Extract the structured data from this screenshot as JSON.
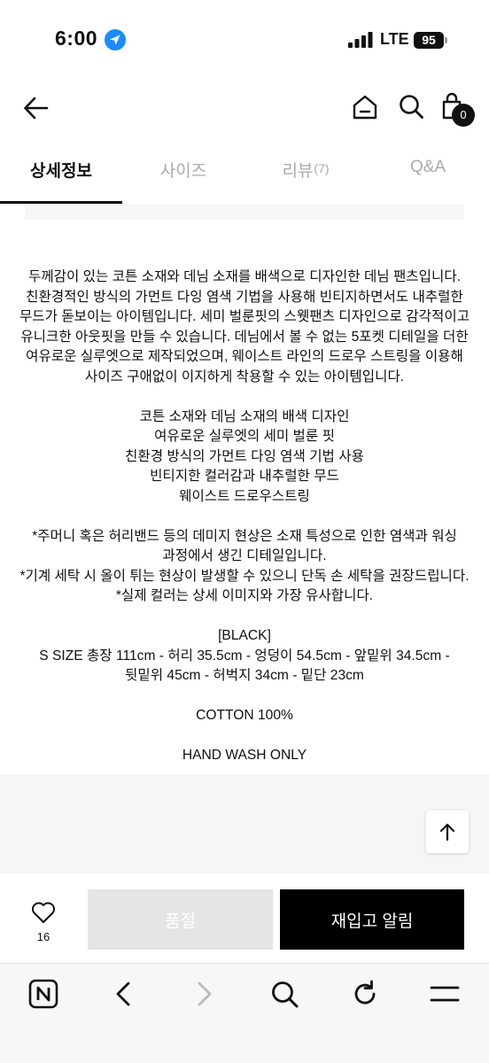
{
  "status_bar": {
    "time": "6:00",
    "network": "LTE",
    "battery": "95"
  },
  "header": {
    "cart_count": "0"
  },
  "tabs": [
    {
      "label": "상세정보",
      "count": ""
    },
    {
      "label": "사이즈",
      "count": ""
    },
    {
      "label": "리뷰",
      "count": "(7)"
    },
    {
      "label": "Q&A",
      "count": ""
    }
  ],
  "description": {
    "intro": [
      "두께감이 있는 코튼 소재와 데님 소재를 배색으로 디자인한 데님 팬츠입니다.",
      "친환경적인 방식의 가먼트 다잉 염색 기법을 사용해 빈티지하면서도 내추럴한",
      "무드가 돋보이는 아이템입니다. 세미 벌룬핏의 스웻팬츠 디자인으로 감각적이고",
      "유니크한 아웃핏을 만들 수 있습니다. 데님에서 볼 수 없는 5포켓 디테일을 더한",
      "여유로운 실루엣으로 제작되었으며, 웨이스트 라인의 드로우 스트링을 이용해",
      "사이즈 구애없이 이지하게 착용할 수 있는 아이템입니다."
    ],
    "features": [
      "코튼 소재와 데님 소재의 배색 디자인",
      "여유로운 실루엣의 세미 벌룬 핏",
      "친환경 방식의 가먼트 다잉 염색 기법 사용",
      "빈티지한 컬러감과 내추럴한 무드",
      "웨이스트 드로우스트링"
    ],
    "notes": [
      "*주머니 혹은 허리밴드 등의 데미지 현상은 소재 특성으로 인한 염색과 워싱",
      "과정에서 생긴 디테일입니다.",
      "*기계 세탁 시 올이 튀는 현상이 발생할 수 있으니 단독 손 세탁을 권장드립니다.",
      "*실제 컬러는 상세 이미지와 가장 유사합니다."
    ],
    "size_info": [
      "[BLACK]",
      "S SIZE 총장 111cm - 허리 35.5cm - 엉덩이 54.5cm - 앞밑위 34.5cm -",
      "뒷밑위 45cm - 허벅지 34cm - 밑단 23cm"
    ],
    "material": "COTTON 100%",
    "care": "HAND WASH ONLY"
  },
  "actions": {
    "like_count": "16",
    "soldout_label": "품절",
    "restock_label": "재입고 알림"
  },
  "colors": {
    "accent": "#111111",
    "soldout_bg": "#e5e5e5",
    "location_blue": "#1a8cff"
  }
}
